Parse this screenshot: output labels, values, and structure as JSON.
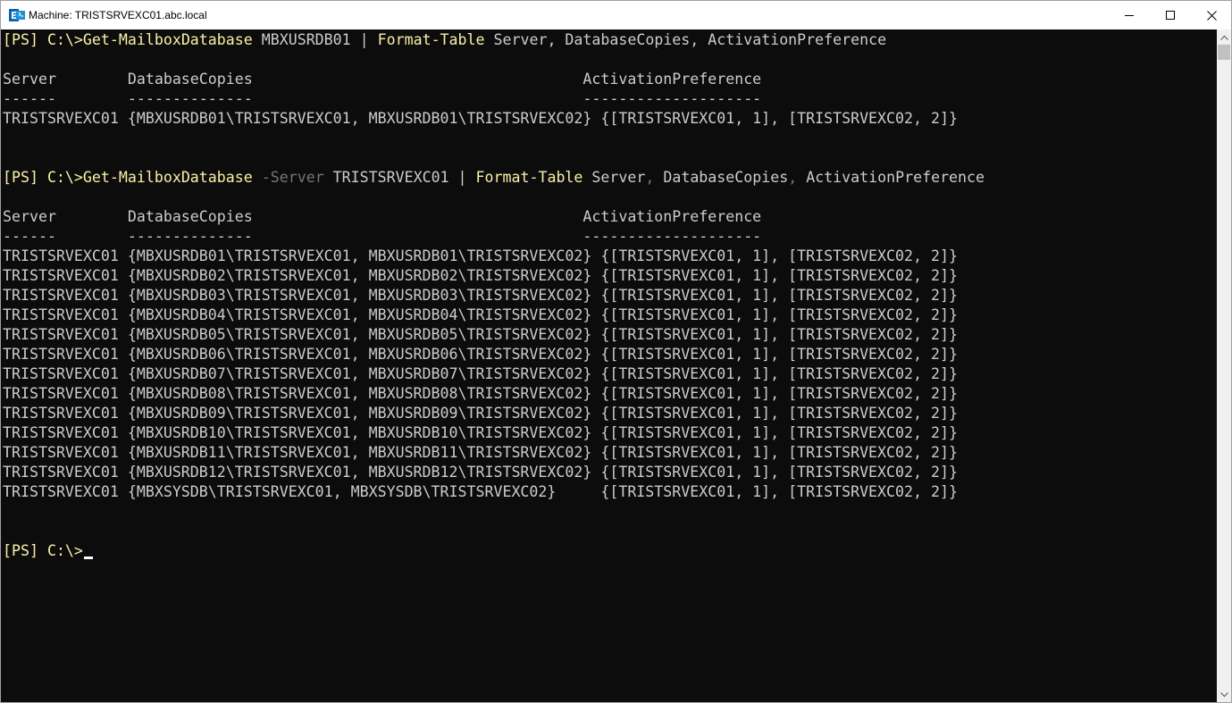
{
  "window": {
    "title": "Machine: TRISTSRVEXC01.abc.local",
    "icon": "exchange-management-shell-icon",
    "buttons": [
      "minimize-icon",
      "maximize-icon",
      "close-icon"
    ]
  },
  "colors": {
    "background": "#0c0c0c",
    "text": "#cccccc",
    "command": "#f9f1a5",
    "parameter": "#767676"
  },
  "console": {
    "lines": [
      [
        [
          "c-prompt",
          "[PS] C:\\>"
        ],
        [
          "c-cmd",
          "Get-MailboxDatabase"
        ],
        [
          "c-default",
          " MBXUSRDB01 | "
        ],
        [
          "c-cmd",
          "Format-Table"
        ],
        [
          "c-default",
          " Server, DatabaseCopies, ActivationPreference"
        ]
      ],
      [
        [
          "c-default",
          ""
        ]
      ],
      [
        [
          "c-default",
          "Server        DatabaseCopies                                     ActivationPreference"
        ]
      ],
      [
        [
          "c-default",
          "------        --------------                                     --------------------"
        ]
      ],
      [
        [
          "c-default",
          "TRISTSRVEXC01 {MBXUSRDB01\\TRISTSRVEXC01, MBXUSRDB01\\TRISTSRVEXC02} {[TRISTSRVEXC01, 1], [TRISTSRVEXC02, 2]}"
        ]
      ],
      [
        [
          "c-default",
          ""
        ]
      ],
      [
        [
          "c-default",
          ""
        ]
      ],
      [
        [
          "c-prompt",
          "[PS] C:\\>"
        ],
        [
          "c-cmd",
          "Get-MailboxDatabase"
        ],
        [
          "c-default",
          " "
        ],
        [
          "c-param",
          "-Server"
        ],
        [
          "c-default",
          " TRISTSRVEXC01 | "
        ],
        [
          "c-cmd",
          "Format-Table"
        ],
        [
          "c-default",
          " Server"
        ],
        [
          "c-param",
          ","
        ],
        [
          "c-default",
          " DatabaseCopies"
        ],
        [
          "c-param",
          ","
        ],
        [
          "c-default",
          " ActivationPreference"
        ]
      ],
      [
        [
          "c-default",
          ""
        ]
      ],
      [
        [
          "c-default",
          "Server        DatabaseCopies                                     ActivationPreference"
        ]
      ],
      [
        [
          "c-default",
          "------        --------------                                     --------------------"
        ]
      ],
      [
        [
          "c-default",
          "TRISTSRVEXC01 {MBXUSRDB01\\TRISTSRVEXC01, MBXUSRDB01\\TRISTSRVEXC02} {[TRISTSRVEXC01, 1], [TRISTSRVEXC02, 2]}"
        ]
      ],
      [
        [
          "c-default",
          "TRISTSRVEXC01 {MBXUSRDB02\\TRISTSRVEXC01, MBXUSRDB02\\TRISTSRVEXC02} {[TRISTSRVEXC01, 1], [TRISTSRVEXC02, 2]}"
        ]
      ],
      [
        [
          "c-default",
          "TRISTSRVEXC01 {MBXUSRDB03\\TRISTSRVEXC01, MBXUSRDB03\\TRISTSRVEXC02} {[TRISTSRVEXC01, 1], [TRISTSRVEXC02, 2]}"
        ]
      ],
      [
        [
          "c-default",
          "TRISTSRVEXC01 {MBXUSRDB04\\TRISTSRVEXC01, MBXUSRDB04\\TRISTSRVEXC02} {[TRISTSRVEXC01, 1], [TRISTSRVEXC02, 2]}"
        ]
      ],
      [
        [
          "c-default",
          "TRISTSRVEXC01 {MBXUSRDB05\\TRISTSRVEXC01, MBXUSRDB05\\TRISTSRVEXC02} {[TRISTSRVEXC01, 1], [TRISTSRVEXC02, 2]}"
        ]
      ],
      [
        [
          "c-default",
          "TRISTSRVEXC01 {MBXUSRDB06\\TRISTSRVEXC01, MBXUSRDB06\\TRISTSRVEXC02} {[TRISTSRVEXC01, 1], [TRISTSRVEXC02, 2]}"
        ]
      ],
      [
        [
          "c-default",
          "TRISTSRVEXC01 {MBXUSRDB07\\TRISTSRVEXC01, MBXUSRDB07\\TRISTSRVEXC02} {[TRISTSRVEXC01, 1], [TRISTSRVEXC02, 2]}"
        ]
      ],
      [
        [
          "c-default",
          "TRISTSRVEXC01 {MBXUSRDB08\\TRISTSRVEXC01, MBXUSRDB08\\TRISTSRVEXC02} {[TRISTSRVEXC01, 1], [TRISTSRVEXC02, 2]}"
        ]
      ],
      [
        [
          "c-default",
          "TRISTSRVEXC01 {MBXUSRDB09\\TRISTSRVEXC01, MBXUSRDB09\\TRISTSRVEXC02} {[TRISTSRVEXC01, 1], [TRISTSRVEXC02, 2]}"
        ]
      ],
      [
        [
          "c-default",
          "TRISTSRVEXC01 {MBXUSRDB10\\TRISTSRVEXC01, MBXUSRDB10\\TRISTSRVEXC02} {[TRISTSRVEXC01, 1], [TRISTSRVEXC02, 2]}"
        ]
      ],
      [
        [
          "c-default",
          "TRISTSRVEXC01 {MBXUSRDB11\\TRISTSRVEXC01, MBXUSRDB11\\TRISTSRVEXC02} {[TRISTSRVEXC01, 1], [TRISTSRVEXC02, 2]}"
        ]
      ],
      [
        [
          "c-default",
          "TRISTSRVEXC01 {MBXUSRDB12\\TRISTSRVEXC01, MBXUSRDB12\\TRISTSRVEXC02} {[TRISTSRVEXC01, 1], [TRISTSRVEXC02, 2]}"
        ]
      ],
      [
        [
          "c-default",
          "TRISTSRVEXC01 {MBXSYSDB\\TRISTSRVEXC01, MBXSYSDB\\TRISTSRVEXC02}     {[TRISTSRVEXC01, 1], [TRISTSRVEXC02, 2]}"
        ]
      ],
      [
        [
          "c-default",
          ""
        ]
      ],
      [
        [
          "c-default",
          ""
        ]
      ],
      [
        [
          "c-prompt",
          "[PS] C:\\>"
        ]
      ]
    ]
  }
}
